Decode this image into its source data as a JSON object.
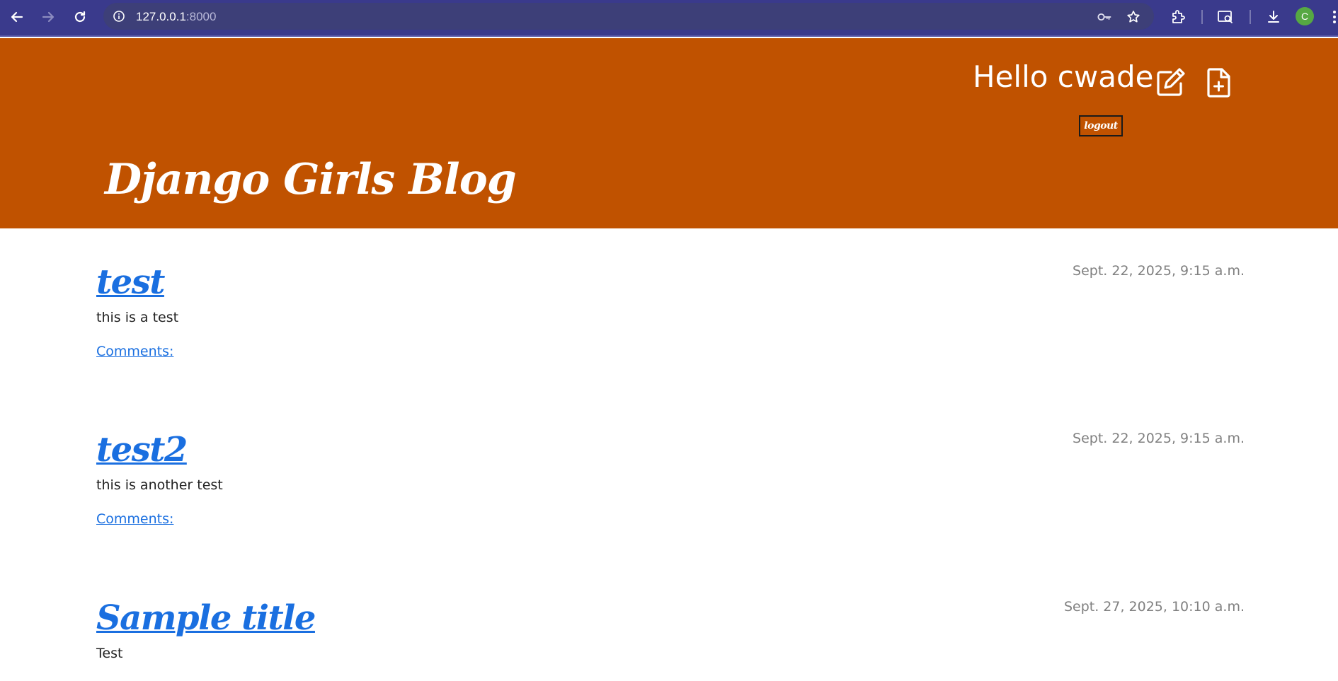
{
  "browser": {
    "url_host": "127.0.0.1",
    "url_port": ":8000",
    "profile_initial": "C",
    "icons": [
      "back-icon",
      "forward-icon",
      "reload-icon",
      "site-info-icon",
      "password-key-icon",
      "bookmark-star-icon",
      "extensions-icon",
      "tab-search-icon",
      "download-icon",
      "profile-avatar",
      "more-menu-icon"
    ]
  },
  "header": {
    "greeting": "Hello cwade",
    "edit_icon": "edit-icon",
    "new_post_icon": "new-post-icon",
    "logout_label": "logout",
    "site_title": "Django Girls Blog",
    "background_color": "#c05200"
  },
  "posts": [
    {
      "title": "test",
      "date": "Sept. 22, 2025, 9:15 a.m.",
      "body": "this is a test",
      "comments_label": "Comments:"
    },
    {
      "title": "test2",
      "date": "Sept. 22, 2025, 9:15 a.m.",
      "body": "this is another test",
      "comments_label": "Comments:"
    },
    {
      "title": "Sample title",
      "date": "Sept. 27, 2025, 10:10 a.m.",
      "body": "Test",
      "comments_label": ""
    }
  ],
  "colors": {
    "link": "#1a6fe0",
    "date_text": "#808080",
    "chrome_bar": "#3a3a8c"
  }
}
